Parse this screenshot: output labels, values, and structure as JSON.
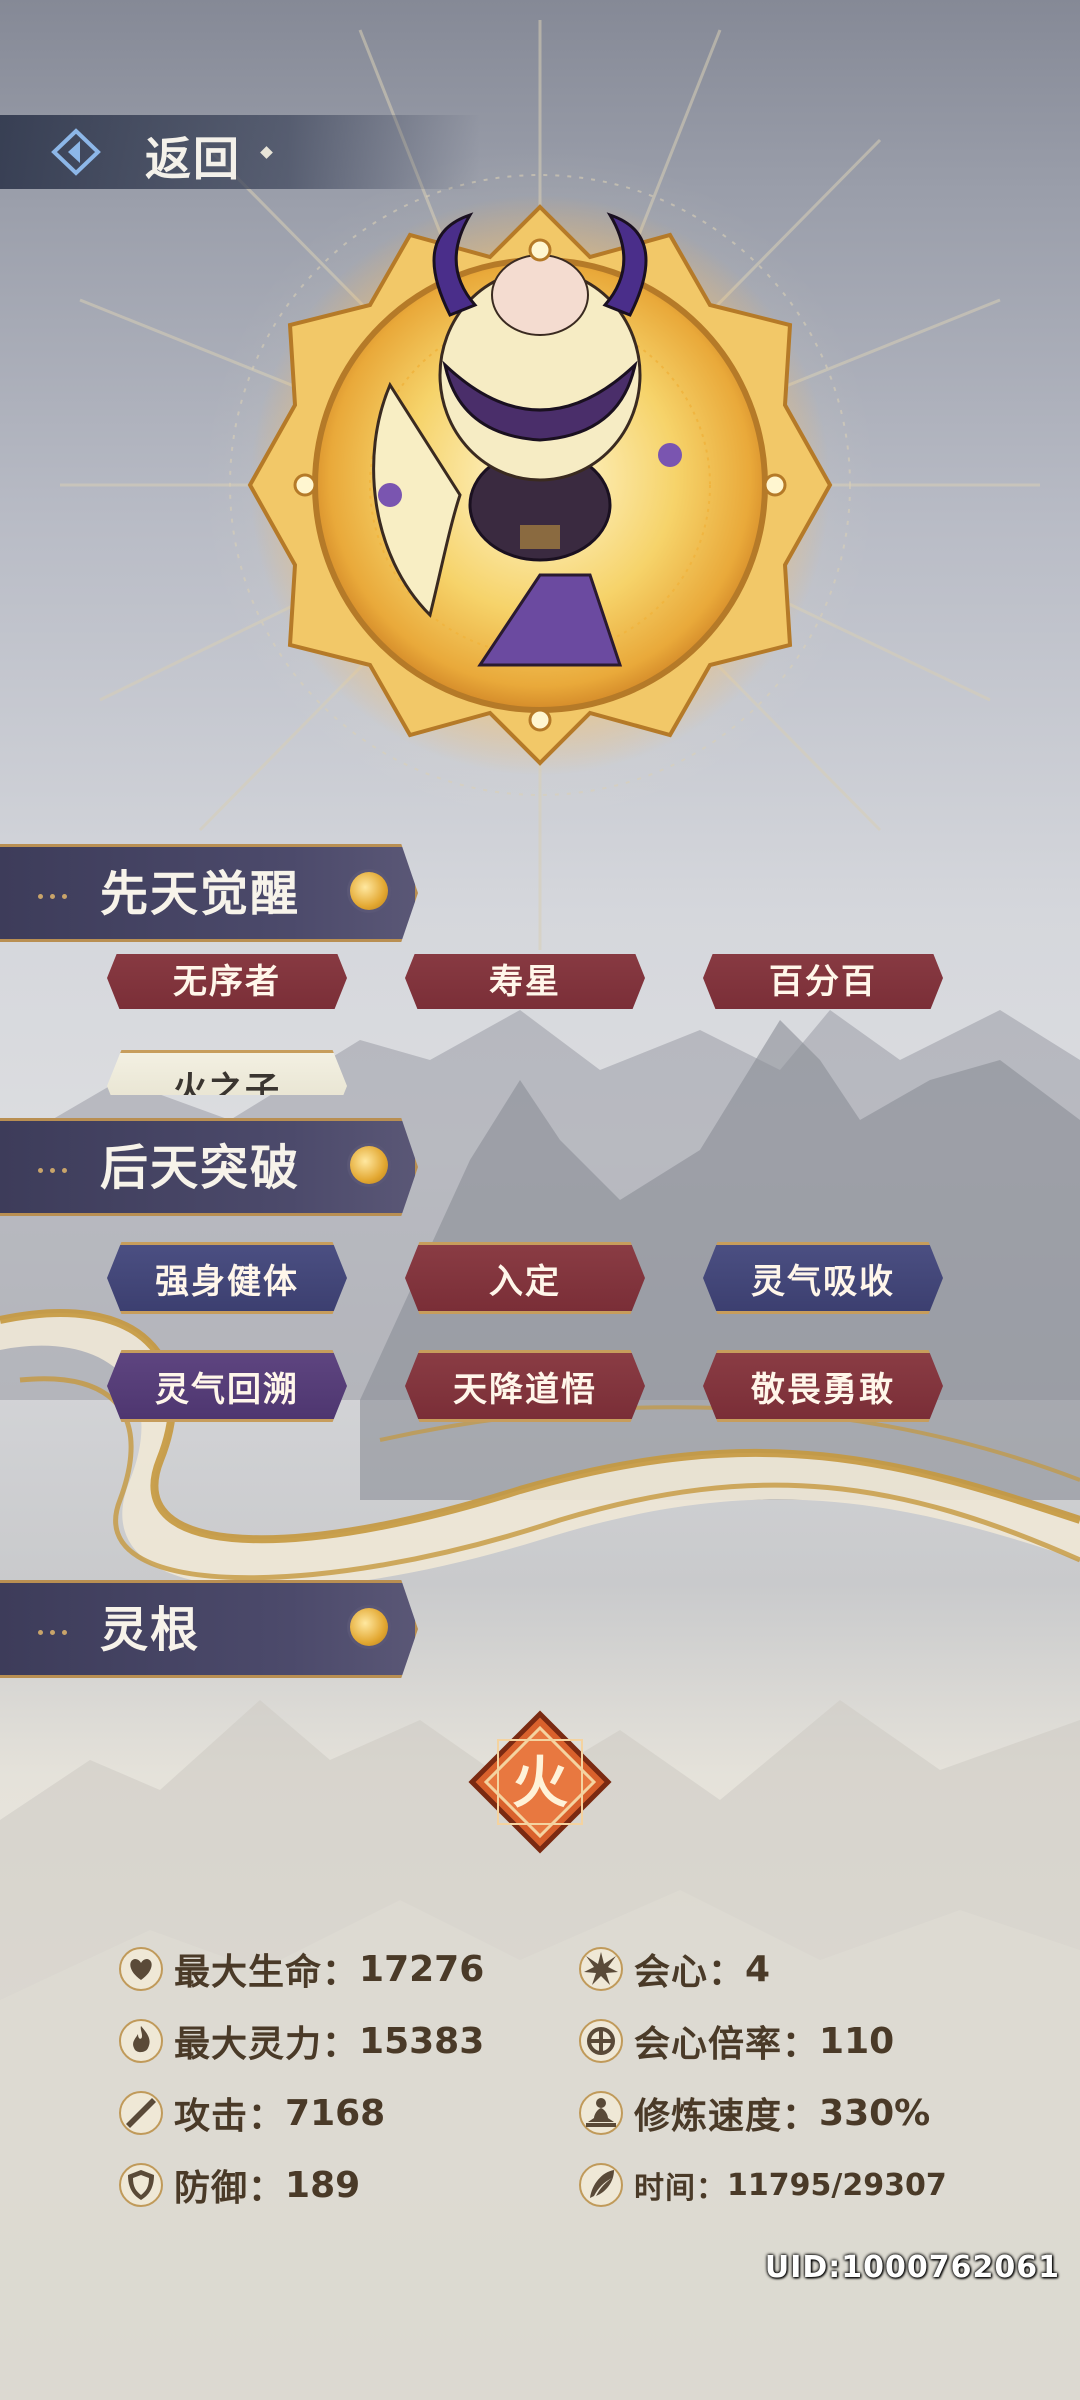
{
  "nav": {
    "back_label": "返回"
  },
  "sections": {
    "innate": {
      "title": "先天觉醒"
    },
    "acquired": {
      "title": "后天突破"
    },
    "root": {
      "title": "灵根"
    }
  },
  "innate_tags": [
    "无序者",
    "寿星",
    "百分百",
    "火之子"
  ],
  "acquired_tags": [
    "强身健体",
    "入定",
    "灵气吸收",
    "灵气回溯",
    "天降道悟",
    "敬畏勇敢"
  ],
  "element": {
    "glyph": "火"
  },
  "stats": {
    "max_hp": {
      "label": "最大生命：",
      "value": "17276"
    },
    "crit": {
      "label": "会心：",
      "value": "4"
    },
    "max_spirit": {
      "label": "最大灵力：",
      "value": "15383"
    },
    "crit_rate": {
      "label": "会心倍率：",
      "value": "110"
    },
    "attack": {
      "label": "攻击：",
      "value": "7168"
    },
    "cultivation_speed": {
      "label": "修炼速度：",
      "value": "330%"
    },
    "defense": {
      "label": "防御：",
      "value": "189"
    },
    "time": {
      "label": "时间：",
      "value": "11795/29307"
    }
  },
  "uid": "UID:1000762061",
  "colors": {
    "accent_gold": "#c79d5c",
    "tag_red": "#7a2e37",
    "tag_blue": "#3c3f70",
    "tag_purple": "#4e3670"
  }
}
